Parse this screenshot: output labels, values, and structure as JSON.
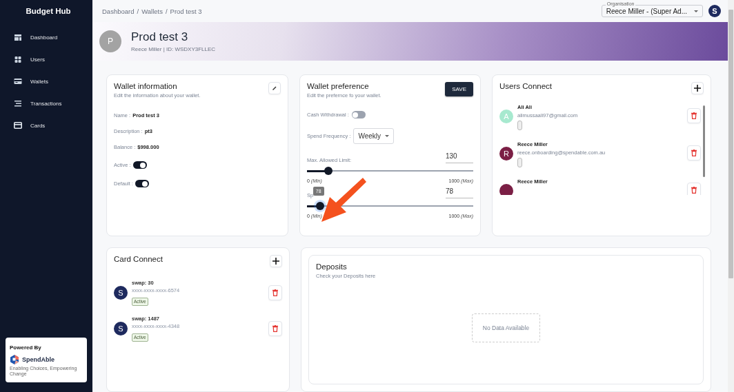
{
  "sidebar": {
    "brand": "Budget Hub",
    "items": [
      {
        "label": "Dashboard",
        "selected": false
      },
      {
        "label": "Users",
        "selected": false
      },
      {
        "label": "Wallets",
        "selected": false
      },
      {
        "label": "Transactions",
        "selected": false
      },
      {
        "label": "Cards",
        "selected": false
      }
    ],
    "powered_by": {
      "label": "Powered By",
      "brand": "SpendAble",
      "tagline": "Enabling Choices, Empowering Change"
    }
  },
  "breadcrumb": {
    "items": [
      "Dashboard",
      "Wallets",
      "Prod test 3"
    ],
    "separator": "/"
  },
  "organisation": {
    "label": "Organisation",
    "value": "Reece Miller - (Super Ad..."
  },
  "account_avatar": "S",
  "banner": {
    "avatar": "P",
    "title": "Prod test 3",
    "subtitle": "Reece Miller | ID: WSDXY3FLLEC"
  },
  "wallet_information": {
    "title": "Wallet information",
    "subtitle": "Edit the information about your wallet.",
    "fields": [
      {
        "label": "Name :",
        "value": "Prod test 3"
      },
      {
        "label": "Description :",
        "value": "pt3"
      },
      {
        "label": "Balance :",
        "value": "$998.000"
      }
    ],
    "toggles": [
      {
        "label": "Active :",
        "on": true
      },
      {
        "label": "Default :",
        "on": true
      }
    ]
  },
  "wallet_preference": {
    "title": "Wallet preference",
    "subtitle": "Edit the prefernce fo your wallet.",
    "save": "SAVE",
    "cash_withdrawal": {
      "label": "Cash Withdrawal :",
      "on": false
    },
    "spend_frequency": {
      "label": "Spend Frequency :",
      "value": "Weekly"
    },
    "sliders": [
      {
        "label": "Max. Allowed Limit:",
        "value": "130",
        "level": 0.13,
        "min": "0",
        "min_note": "(Min)",
        "max": "1000",
        "max_note": "(Max)"
      },
      {
        "label": "Sp",
        "value": "78",
        "level": 0.078,
        "min": "0",
        "min_note": "(Min)",
        "max": "1000",
        "max_note": "(Max)",
        "tooltip": "78"
      }
    ]
  },
  "users_connect": {
    "title": "Users Connect",
    "users": [
      {
        "avatar": "A",
        "color": "#a7e9cf",
        "name": "Ali Ali",
        "email": "alimussaali97@gmail.com"
      },
      {
        "avatar": "R",
        "color": "#7b1f45",
        "name": "Reece Miller",
        "email": "reece.onboarding@spendable.com.au"
      },
      {
        "color": "#7b1f45",
        "name": "Reece Miller"
      }
    ]
  },
  "card_connect": {
    "title": "Card Connect",
    "cards": [
      {
        "avatar": "S",
        "name": "swap: 30",
        "number": "xxxx-xxxx-xxxx-6574",
        "status": "Active"
      },
      {
        "avatar": "S",
        "name": "swap: 1487",
        "number": "xxxx-xxxx-xxxx-4348",
        "status": "Active"
      }
    ]
  },
  "deposits": {
    "title": "Deposits",
    "subtitle": "Check your Deposits here",
    "empty": "No Data Available"
  }
}
